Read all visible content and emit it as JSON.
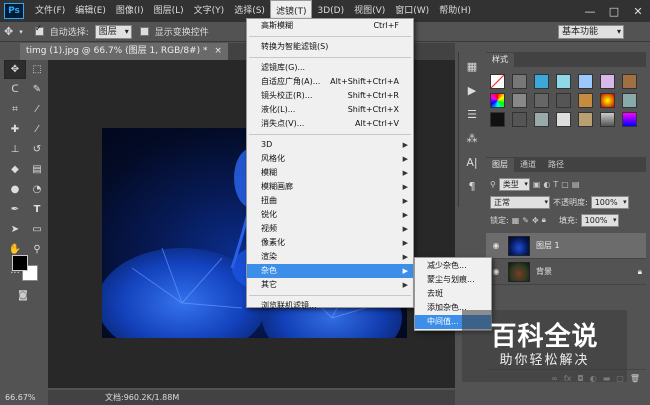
{
  "app": {
    "logo": "Ps",
    "workspace": "基本功能"
  },
  "menubar": {
    "items": [
      "文件(F)",
      "编辑(E)",
      "图像(I)",
      "图层(L)",
      "文字(Y)",
      "选择(S)",
      "滤镜(T)",
      "3D(D)",
      "视图(V)",
      "窗口(W)",
      "帮助(H)"
    ],
    "active_index": 6
  },
  "window_controls": {
    "minimize": "—",
    "maximize": "□",
    "close": "✕"
  },
  "options_bar": {
    "auto_select_label": "自动选择:",
    "auto_select_value": "图层",
    "show_transform_label": "显示变换控件"
  },
  "document_tab": {
    "title": "timg (1).jpg @ 66.7% (图层 1, RGB/8#) *",
    "close": "×"
  },
  "status": {
    "zoom": "66.67%",
    "doc_info": "文档:960.2K/1.88M"
  },
  "filter_menu": {
    "items": [
      {
        "label": "高斯模糊",
        "shortcut": "Ctrl+F"
      },
      {
        "sep": true
      },
      {
        "label": "转换为智能滤镜(S)"
      },
      {
        "sep": true
      },
      {
        "label": "滤镜库(G)..."
      },
      {
        "label": "自适应广角(A)...",
        "shortcut": "Alt+Shift+Ctrl+A"
      },
      {
        "label": "镜头校正(R)...",
        "shortcut": "Shift+Ctrl+R"
      },
      {
        "label": "液化(L)...",
        "shortcut": "Shift+Ctrl+X"
      },
      {
        "label": "消失点(V)...",
        "shortcut": "Alt+Ctrl+V"
      },
      {
        "sep": true
      },
      {
        "label": "3D",
        "sub": true
      },
      {
        "label": "风格化",
        "sub": true
      },
      {
        "label": "模糊",
        "sub": true
      },
      {
        "label": "模糊画廊",
        "sub": true
      },
      {
        "label": "扭曲",
        "sub": true
      },
      {
        "label": "锐化",
        "sub": true
      },
      {
        "label": "视频",
        "sub": true
      },
      {
        "label": "像素化",
        "sub": true
      },
      {
        "label": "渲染",
        "sub": true
      },
      {
        "label": "杂色",
        "sub": true,
        "active": true
      },
      {
        "label": "其它",
        "sub": true
      },
      {
        "sep": true
      },
      {
        "label": "浏览联机滤镜..."
      }
    ]
  },
  "noise_menu": {
    "items": [
      "减少杂色...",
      "蒙尘与划痕...",
      "去斑",
      "添加杂色...",
      "中间值..."
    ],
    "active_index": 4
  },
  "styles_panel": {
    "tabs": [
      "样式"
    ]
  },
  "layers_panel": {
    "tabs": [
      "图层",
      "通道",
      "路径"
    ],
    "kind_label": "类型",
    "blend_mode": "正常",
    "opacity_label": "不透明度:",
    "opacity_value": "100%",
    "lock_label": "锁定:",
    "fill_label": "填充:",
    "fill_value": "100%",
    "layers": [
      {
        "name": "图层 1",
        "active": true
      },
      {
        "name": "背景",
        "locked": true
      }
    ]
  },
  "watermark": {
    "main": "百科全说",
    "sub": "助你轻松解决"
  },
  "colors": {
    "accent": "#3c8ee8",
    "foreground": "#000000",
    "background": "#ffffff"
  }
}
